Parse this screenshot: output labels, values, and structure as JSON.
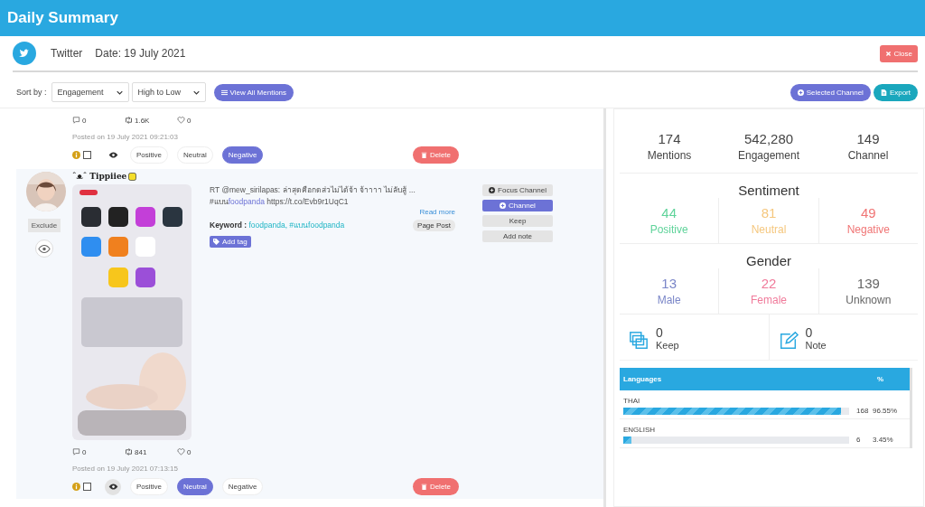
{
  "header": {
    "title": "Daily Summary"
  },
  "channel": {
    "name": "Twitter",
    "date": "Date: 19 July 2021"
  },
  "close_button": "Close",
  "sort": {
    "label": "Sort by :",
    "field": "Engagement",
    "order": "High to Low"
  },
  "view_all_button": "View All Mentions",
  "selected_channel_button": "Selected Channel",
  "export_button": "Export",
  "posts": [
    {
      "comments": "0",
      "retweets": "1.6K",
      "likes": "0",
      "posted": "Posted on 19 July 2021 09:21:03",
      "checked": false,
      "sentiments": [
        {
          "label": "Positive",
          "selected": false
        },
        {
          "label": "Neutral",
          "selected": false
        },
        {
          "label": "Negative",
          "selected": true
        }
      ],
      "delete_button": "Delete"
    },
    {
      "author": "ˆᴥˆ Tippiiee",
      "exclude_button": "Exclude",
      "text": "RT @mew_sirilapas: ล่าสุดคือกดส่วไม่ได้จ้า จ้าาาา ไม่ลับสู้ ...",
      "text_line2": [
        {
          "text": "#แบน",
          "highlight": false
        },
        {
          "text": "foodpanda",
          "highlight": true
        },
        {
          "text": " https://t.co/Evb9r1UqC1",
          "highlight": false
        }
      ],
      "read_more": "Read more",
      "keyword_label": "Keyword :",
      "keywords": "foodpanda, #แบนfoodpanda",
      "page_post": "Page Post",
      "add_tag_button": "Add tag",
      "actions": [
        {
          "label": "Focus Channel",
          "kind": "focus",
          "selected": false
        },
        {
          "label": "Channel",
          "kind": "channel",
          "selected": true
        },
        {
          "label": "Keep",
          "kind": "plain",
          "selected": false
        },
        {
          "label": "Add note",
          "kind": "plain",
          "selected": false
        }
      ],
      "comments": "0",
      "retweets": "841",
      "likes": "0",
      "posted": "Posted on 19 July 2021 07:13:15",
      "checked": false,
      "sentiments": [
        {
          "label": "Positive",
          "selected": false
        },
        {
          "label": "Neutral",
          "selected": true
        },
        {
          "label": "Negative",
          "selected": false
        }
      ],
      "delete_button": "Delete"
    }
  ],
  "stats": [
    {
      "value": "174",
      "label": "Mentions"
    },
    {
      "value": "542,280",
      "label": "Engagement"
    },
    {
      "value": "149",
      "label": "Channel"
    }
  ],
  "sentiment": {
    "title": "Sentiment",
    "items": [
      {
        "value": "44",
        "label": "Positive",
        "color": "#5fd39a"
      },
      {
        "value": "81",
        "label": "Neutral",
        "color": "#f5c77e"
      },
      {
        "value": "49",
        "label": "Negative",
        "color": "#f07575"
      }
    ]
  },
  "gender": {
    "title": "Gender",
    "items": [
      {
        "value": "13",
        "label": "Male",
        "color": "#7a86c8"
      },
      {
        "value": "22",
        "label": "Female",
        "color": "#f07a9a"
      },
      {
        "value": "139",
        "label": "Unknown",
        "color": "#666666"
      }
    ]
  },
  "counters": [
    {
      "kind": "keep",
      "value": "0",
      "label": "Keep"
    },
    {
      "kind": "note",
      "value": "0",
      "label": "Note"
    }
  ],
  "languages": {
    "columns": [
      "Languages",
      "%"
    ],
    "rows": [
      {
        "name": "THAI",
        "level": 0.9655,
        "count": "168",
        "percent": "96.55%"
      },
      {
        "name": "ENGLISH",
        "level": 0.0345,
        "count": "6",
        "percent": "3.45%"
      }
    ]
  }
}
